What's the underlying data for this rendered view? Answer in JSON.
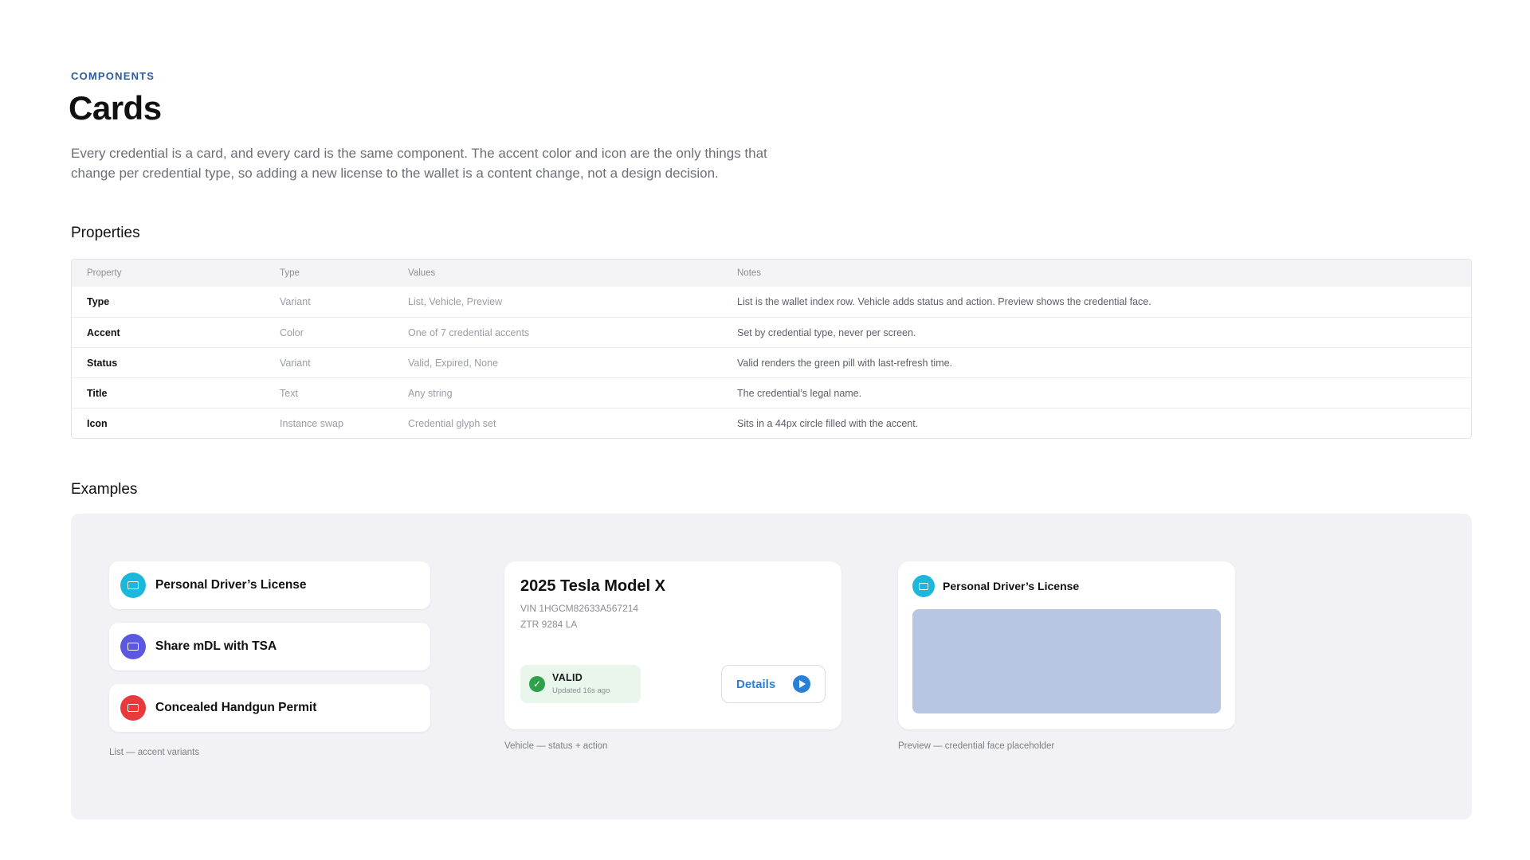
{
  "header": {
    "eyebrow": "COMPONENTS",
    "title": "Cards",
    "intro": "Every credential is a card, and every card is the same component. The accent color and icon are the only things that change per credential type, so adding a new license to the wallet is a content change, not a design decision."
  },
  "properties": {
    "heading": "Properties",
    "columns": [
      "Property",
      "Type",
      "Values",
      "Notes"
    ],
    "rows": [
      {
        "property": "Type",
        "type": "Variant",
        "values": "List, Vehicle, Preview",
        "notes": "List is the wallet index row. Vehicle adds status and action. Preview shows the credential face."
      },
      {
        "property": "Accent",
        "type": "Color",
        "values": "One of 7 credential accents",
        "notes": "Set by credential type, never per screen."
      },
      {
        "property": "Status",
        "type": "Variant",
        "values": "Valid, Expired, None",
        "notes": "Valid renders the green pill with last-refresh time."
      },
      {
        "property": "Title",
        "type": "Text",
        "values": "Any string",
        "notes": "The credential’s legal name."
      },
      {
        "property": "Icon",
        "type": "Instance swap",
        "values": "Credential glyph set",
        "notes": "Sits in a 44px circle filled with the accent."
      }
    ]
  },
  "examples": {
    "heading": "Examples",
    "list_cards": [
      {
        "title": "Personal Driver’s License",
        "accent": "#1bb8dc",
        "icon": "id-card-icon"
      },
      {
        "title": "Share mDL with TSA",
        "accent": "#5b57e0",
        "icon": "id-card-icon"
      },
      {
        "title": "Concealed Handgun Permit",
        "accent": "#e83a3a",
        "icon": "id-card-icon"
      }
    ],
    "list_caption": "List — accent variants",
    "vehicle": {
      "title": "2025 Tesla Model X",
      "vin": "VIN 1HGCM82633A567214",
      "plate": "ZTR 9284 LA",
      "status": "VALID",
      "updated": "Updated 16s ago",
      "status_color": "#2fa14b",
      "action_label": "Details",
      "action_color": "#2a7fd6",
      "caption": "Vehicle — status + action"
    },
    "preview": {
      "title": "Personal Driver’s License",
      "accent": "#1bb8dc",
      "icon": "id-card-icon",
      "face_color": "#b7c6e3",
      "caption": "Preview — credential face placeholder"
    }
  }
}
